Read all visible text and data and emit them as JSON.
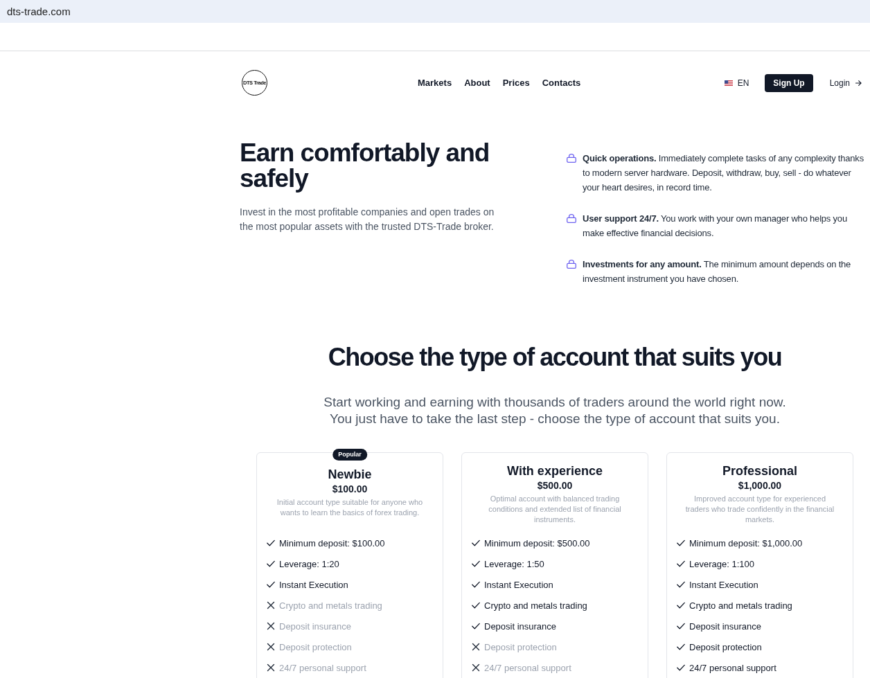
{
  "browser": {
    "url": "dts-trade.com"
  },
  "header": {
    "logo": "DTS Trade",
    "nav": [
      "Markets",
      "About",
      "Prices",
      "Contacts"
    ],
    "language": "EN",
    "signup": "Sign Up",
    "login": "Login"
  },
  "hero": {
    "title": "Earn comfortably and safely",
    "text": "Invest in the most profitable companies and open trades on the most popular assets with the trusted DTS-Trade broker.",
    "features": [
      "**Quick operations.** Immediately complete tasks of any complexity thanks to modern server hardware. Deposit, withdraw, buy, sell - do whatever your heart desires, in record time.",
      "**User support 24/7.** You work with your own manager who helps you make effective financial decisions.",
      "**Investments for any amount.** The minimum amount depends on the investment instrument you have chosen."
    ]
  },
  "accounts": {
    "title": "Choose the type of account that suits you",
    "subtitle": "Start working and earning with thousands of traders around the world right now. You just have to take the last step - choose the type of account that suits you.",
    "plans": [
      {
        "badge": "Popular",
        "name": "Newbie",
        "price": "$100.00",
        "description": "Initial account type suitable for anyone who wants to learn the basics of forex trading.",
        "features": [
          {
            "text": "Minimum deposit: $100.00",
            "included": true
          },
          {
            "text": "Leverage: 1:20",
            "included": true
          },
          {
            "text": "Instant Execution",
            "included": true
          },
          {
            "text": "Crypto and metals trading",
            "included": false
          },
          {
            "text": "Deposit insurance",
            "included": false
          },
          {
            "text": "Deposit protection",
            "included": false
          },
          {
            "text": "24/7 personal support",
            "included": false
          }
        ]
      },
      {
        "name": "With experience",
        "price": "$500.00",
        "description": "Optimal account with balanced trading conditions and extended list of financial instruments.",
        "features": [
          {
            "text": "Minimum deposit: $500.00",
            "included": true
          },
          {
            "text": "Leverage: 1:50",
            "included": true
          },
          {
            "text": "Instant Execution",
            "included": true
          },
          {
            "text": "Crypto and metals trading",
            "included": true
          },
          {
            "text": "Deposit insurance",
            "included": true
          },
          {
            "text": "Deposit protection",
            "included": false
          },
          {
            "text": "24/7 personal support",
            "included": false
          }
        ]
      },
      {
        "name": "Professional",
        "price": "$1,000.00",
        "description": "Improved account type for experienced traders who trade confidently in the financial markets.",
        "features": [
          {
            "text": "Minimum deposit: $1,000.00",
            "included": true
          },
          {
            "text": "Leverage: 1:100",
            "included": true
          },
          {
            "text": "Instant Execution",
            "included": true
          },
          {
            "text": "Crypto and metals trading",
            "included": true
          },
          {
            "text": "Deposit insurance",
            "included": true
          },
          {
            "text": "Deposit protection",
            "included": true
          },
          {
            "text": "24/7 personal support",
            "included": true
          }
        ]
      }
    ]
  }
}
